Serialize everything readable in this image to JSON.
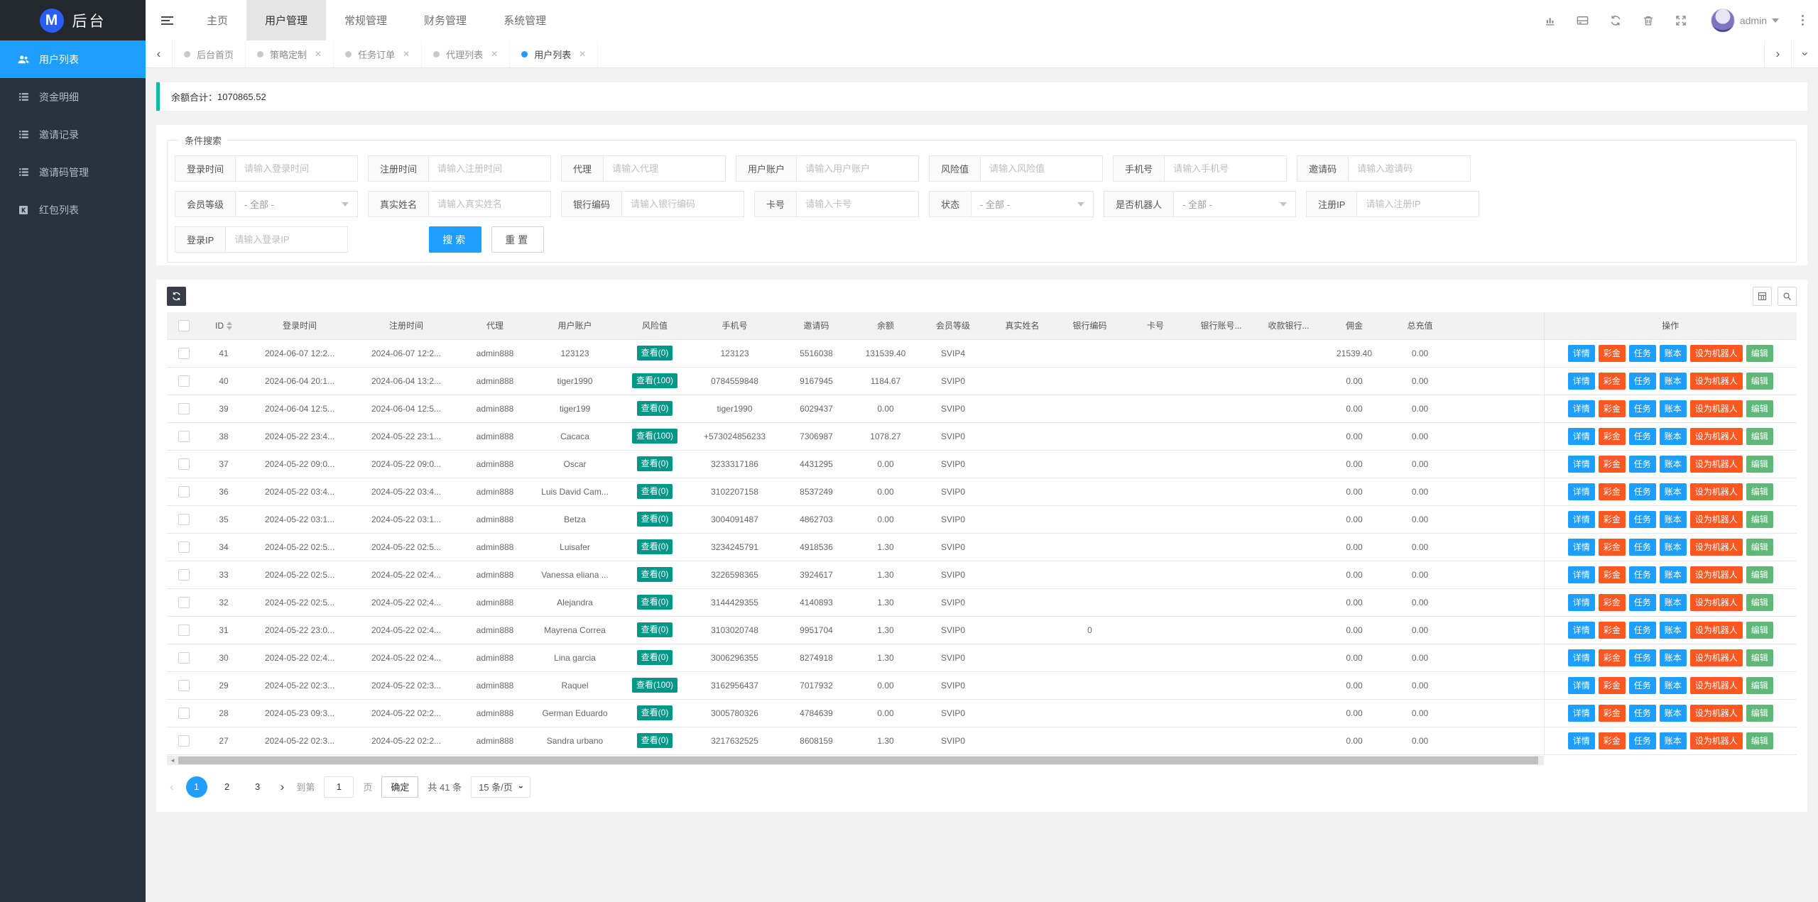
{
  "navbar": {
    "logo_letter": "M",
    "logo_text": "后台",
    "menu": [
      "主页",
      "用户管理",
      "常规管理",
      "财务管理",
      "系统管理"
    ],
    "active_menu": "用户管理",
    "username": "admin",
    "right_icons": [
      "bar-chart-icon",
      "credit-card-icon",
      "refresh-icon",
      "trash-icon",
      "fullscreen-icon",
      "more-vertical-icon"
    ]
  },
  "tabs": [
    {
      "label": "后台首页",
      "closable": false,
      "active": false
    },
    {
      "label": "策略定制",
      "closable": true,
      "active": false
    },
    {
      "label": "任务订单",
      "closable": true,
      "active": false
    },
    {
      "label": "代理列表",
      "closable": true,
      "active": false
    },
    {
      "label": "用户列表",
      "closable": true,
      "active": true
    }
  ],
  "sidebar": {
    "items": [
      {
        "label": "用户列表",
        "icon": "users-icon",
        "active": true
      },
      {
        "label": "资金明细",
        "icon": "list-icon",
        "active": false
      },
      {
        "label": "邀请记录",
        "icon": "list-icon",
        "active": false
      },
      {
        "label": "邀请码管理",
        "icon": "list-icon",
        "active": false
      },
      {
        "label": "红包列表",
        "icon": "red-packet-icon",
        "active": false
      }
    ]
  },
  "notice": {
    "label": "余额合计：",
    "value": "1070865.52"
  },
  "search": {
    "legend": "条件搜索",
    "rows": [
      [
        {
          "label": "登录时间",
          "placeholder": "请输入登录时间",
          "type": "input"
        },
        {
          "label": "注册时间",
          "placeholder": "请输入注册时间",
          "type": "input"
        },
        {
          "label": "代理",
          "placeholder": "请输入代理",
          "type": "input"
        },
        {
          "label": "用户账户",
          "placeholder": "请输入用户账户",
          "type": "input"
        },
        {
          "label": "风险值",
          "placeholder": "请输入风险值",
          "type": "input"
        },
        {
          "label": "手机号",
          "placeholder": "请输入手机号",
          "type": "input"
        },
        {
          "label": "邀请码",
          "placeholder": "请输入邀请码",
          "type": "input"
        }
      ],
      [
        {
          "label": "会员等级",
          "value": "- 全部 -",
          "type": "select"
        },
        {
          "label": "真实姓名",
          "placeholder": "请输入真实姓名",
          "type": "input"
        },
        {
          "label": "银行编码",
          "placeholder": "请输入银行编码",
          "type": "input"
        },
        {
          "label": "卡号",
          "placeholder": "请输入卡号",
          "type": "input"
        },
        {
          "label": "状态",
          "value": "- 全部 -",
          "type": "select"
        },
        {
          "label": "是否机器人",
          "value": "- 全部 -",
          "type": "select"
        },
        {
          "label": "注册IP",
          "placeholder": "请输入注册IP",
          "type": "input"
        }
      ],
      [
        {
          "label": "登录IP",
          "placeholder": "请输入登录IP",
          "type": "input"
        }
      ]
    ],
    "search_button": "搜索",
    "reset_button": "重置"
  },
  "table": {
    "columns": [
      "ID",
      "登录时间",
      "注册时间",
      "代理",
      "用户账户",
      "风险值",
      "手机号",
      "邀请码",
      "余额",
      "会员等级",
      "真实姓名",
      "银行编码",
      "卡号",
      "银行账号...",
      "收款银行...",
      "佣金",
      "总充值"
    ],
    "sort_column": "ID",
    "ops_label": "操作",
    "actions": [
      {
        "label": "详情",
        "color": "blue"
      },
      {
        "label": "彩金",
        "color": "red"
      },
      {
        "label": "任务",
        "color": "blue"
      },
      {
        "label": "账本",
        "color": "blue"
      },
      {
        "label": "设为机器人",
        "color": "red"
      },
      {
        "label": "编辑",
        "color": "green"
      }
    ],
    "rows": [
      {
        "id": "41",
        "login": "2024-06-07 12:2...",
        "reg": "2024-06-07 12:2...",
        "agent": "admin888",
        "account": "123123",
        "risk": "查看(0)",
        "phone": "123123",
        "invite": "5516038",
        "balance": "131539.40",
        "level": "SVIP4",
        "real_name": "",
        "bank_code": "",
        "card": "",
        "bank_account": "",
        "recv_bank": "",
        "commission": "21539.40",
        "recharge": "0.00"
      },
      {
        "id": "40",
        "login": "2024-06-04 20:1...",
        "reg": "2024-06-04 13:2...",
        "agent": "admin888",
        "account": "tiger1990",
        "risk": "查看(100)",
        "phone": "0784559848",
        "invite": "9167945",
        "balance": "1184.67",
        "level": "SVIP0",
        "real_name": "",
        "bank_code": "",
        "card": "",
        "bank_account": "",
        "recv_bank": "",
        "commission": "0.00",
        "recharge": "0.00"
      },
      {
        "id": "39",
        "login": "2024-06-04 12:5...",
        "reg": "2024-06-04 12:5...",
        "agent": "admin888",
        "account": "tiger199",
        "risk": "查看(0)",
        "phone": "tiger1990",
        "invite": "6029437",
        "balance": "0.00",
        "level": "SVIP0",
        "real_name": "",
        "bank_code": "",
        "card": "",
        "bank_account": "",
        "recv_bank": "",
        "commission": "0.00",
        "recharge": "0.00"
      },
      {
        "id": "38",
        "login": "2024-05-22 23:4...",
        "reg": "2024-05-22 23:1...",
        "agent": "admin888",
        "account": "Cacaca",
        "risk": "查看(100)",
        "phone": "+573024856233",
        "invite": "7306987",
        "balance": "1078.27",
        "level": "SVIP0",
        "real_name": "",
        "bank_code": "",
        "card": "",
        "bank_account": "",
        "recv_bank": "",
        "commission": "0.00",
        "recharge": "0.00"
      },
      {
        "id": "37",
        "login": "2024-05-22 09:0...",
        "reg": "2024-05-22 09:0...",
        "agent": "admin888",
        "account": "Oscar",
        "risk": "查看(0)",
        "phone": "3233317186",
        "invite": "4431295",
        "balance": "0.00",
        "level": "SVIP0",
        "real_name": "",
        "bank_code": "",
        "card": "",
        "bank_account": "",
        "recv_bank": "",
        "commission": "0.00",
        "recharge": "0.00"
      },
      {
        "id": "36",
        "login": "2024-05-22 03:4...",
        "reg": "2024-05-22 03:4...",
        "agent": "admin888",
        "account": "Luis David Cam...",
        "risk": "查看(0)",
        "phone": "3102207158",
        "invite": "8537249",
        "balance": "0.00",
        "level": "SVIP0",
        "real_name": "",
        "bank_code": "",
        "card": "",
        "bank_account": "",
        "recv_bank": "",
        "commission": "0.00",
        "recharge": "0.00"
      },
      {
        "id": "35",
        "login": "2024-05-22 03:1...",
        "reg": "2024-05-22 03:1...",
        "agent": "admin888",
        "account": "Betza",
        "risk": "查看(0)",
        "phone": "3004091487",
        "invite": "4862703",
        "balance": "0.00",
        "level": "SVIP0",
        "real_name": "",
        "bank_code": "",
        "card": "",
        "bank_account": "",
        "recv_bank": "",
        "commission": "0.00",
        "recharge": "0.00"
      },
      {
        "id": "34",
        "login": "2024-05-22 02:5...",
        "reg": "2024-05-22 02:5...",
        "agent": "admin888",
        "account": "Luisafer",
        "risk": "查看(0)",
        "phone": "3234245791",
        "invite": "4918536",
        "balance": "1.30",
        "level": "SVIP0",
        "real_name": "",
        "bank_code": "",
        "card": "",
        "bank_account": "",
        "recv_bank": "",
        "commission": "0.00",
        "recharge": "0.00"
      },
      {
        "id": "33",
        "login": "2024-05-22 02:5...",
        "reg": "2024-05-22 02:4...",
        "agent": "admin888",
        "account": "Vanessa eliana ...",
        "risk": "查看(0)",
        "phone": "3226598365",
        "invite": "3924617",
        "balance": "1.30",
        "level": "SVIP0",
        "real_name": "",
        "bank_code": "",
        "card": "",
        "bank_account": "",
        "recv_bank": "",
        "commission": "0.00",
        "recharge": "0.00"
      },
      {
        "id": "32",
        "login": "2024-05-22 02:5...",
        "reg": "2024-05-22 02:4...",
        "agent": "admin888",
        "account": "Alejandra",
        "risk": "查看(0)",
        "phone": "3144429355",
        "invite": "4140893",
        "balance": "1.30",
        "level": "SVIP0",
        "real_name": "",
        "bank_code": "",
        "card": "",
        "bank_account": "",
        "recv_bank": "",
        "commission": "0.00",
        "recharge": "0.00"
      },
      {
        "id": "31",
        "login": "2024-05-22 23:0...",
        "reg": "2024-05-22 02:4...",
        "agent": "admin888",
        "account": "Mayrena Correa",
        "risk": "查看(0)",
        "phone": "3103020748",
        "invite": "9951704",
        "balance": "1.30",
        "level": "SVIP0",
        "real_name": "",
        "bank_code": "0",
        "card": "",
        "bank_account": "",
        "recv_bank": "",
        "commission": "0.00",
        "recharge": "0.00"
      },
      {
        "id": "30",
        "login": "2024-05-22 02:4...",
        "reg": "2024-05-22 02:4...",
        "agent": "admin888",
        "account": "Lina garcia",
        "risk": "查看(0)",
        "phone": "3006296355",
        "invite": "8274918",
        "balance": "1.30",
        "level": "SVIP0",
        "real_name": "",
        "bank_code": "",
        "card": "",
        "bank_account": "",
        "recv_bank": "",
        "commission": "0.00",
        "recharge": "0.00"
      },
      {
        "id": "29",
        "login": "2024-05-22 02:3...",
        "reg": "2024-05-22 02:3...",
        "agent": "admin888",
        "account": "Raquel",
        "risk": "查看(100)",
        "phone": "3162956437",
        "invite": "7017932",
        "balance": "0.00",
        "level": "SVIP0",
        "real_name": "",
        "bank_code": "",
        "card": "",
        "bank_account": "",
        "recv_bank": "",
        "commission": "0.00",
        "recharge": "0.00"
      },
      {
        "id": "28",
        "login": "2024-05-23 09:3...",
        "reg": "2024-05-22 02:2...",
        "agent": "admin888",
        "account": "German Eduardo",
        "risk": "查看(0)",
        "phone": "3005780326",
        "invite": "4784639",
        "balance": "0.00",
        "level": "SVIP0",
        "real_name": "",
        "bank_code": "",
        "card": "",
        "bank_account": "",
        "recv_bank": "",
        "commission": "0.00",
        "recharge": "0.00"
      },
      {
        "id": "27",
        "login": "2024-05-22 02:3...",
        "reg": "2024-05-22 02:2...",
        "agent": "admin888",
        "account": "Sandra urbano",
        "risk": "查看(0)",
        "phone": "3217632525",
        "invite": "8608159",
        "balance": "1.30",
        "level": "SVIP0",
        "real_name": "",
        "bank_code": "",
        "card": "",
        "bank_account": "",
        "recv_bank": "",
        "commission": "0.00",
        "recharge": "0.00"
      }
    ]
  },
  "pagination": {
    "pages": [
      "1",
      "2",
      "3"
    ],
    "active_page": "1",
    "goto_label": "到第",
    "page_input_value": "1",
    "page_unit_label": "页",
    "confirm_label": "确定",
    "total_label": "共 41 条",
    "page_size_label": "15 条/页"
  },
  "colors": {
    "accent": "#1e9fff",
    "danger": "#ff5722",
    "success": "#5fb878",
    "risk_badge": "#009688",
    "notice_border": "#16baaa",
    "sidebar_bg": "#28333e",
    "header_dark": "#23272e"
  }
}
